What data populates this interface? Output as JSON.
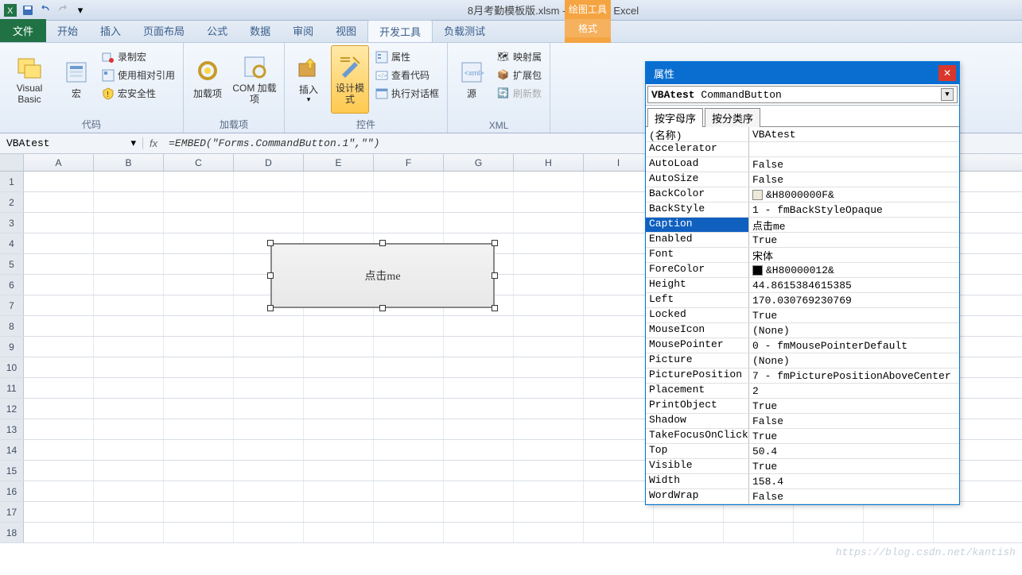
{
  "app": {
    "filename": "8月考勤模板版.xlsm",
    "appname": "Microsoft Excel",
    "context_tool": "绘图工具",
    "context_sub": "格式"
  },
  "tabs": {
    "file": "文件",
    "items": [
      "开始",
      "插入",
      "页面布局",
      "公式",
      "数据",
      "审阅",
      "视图",
      "开发工具",
      "负载测试"
    ],
    "active_index": 7
  },
  "ribbon": {
    "group_code": {
      "label": "代码",
      "vb": "Visual Basic",
      "macros": "宏",
      "record": "录制宏",
      "relative": "使用相对引用",
      "security": "宏安全性"
    },
    "group_addins": {
      "label": "加载项",
      "addins": "加载项",
      "com": "COM 加载项"
    },
    "group_controls": {
      "label": "控件",
      "insert": "插入",
      "design": "设计模式",
      "props": "属性",
      "view_code": "查看代码",
      "dialog": "执行对话框"
    },
    "group_xml": {
      "label": "XML",
      "source": "源",
      "map_props": "映射属",
      "exp_pack": "扩展包",
      "refresh": "刷新数"
    }
  },
  "formula": {
    "name_box": "VBAtest",
    "fx": "fx",
    "value": "=EMBED(\"Forms.CommandButton.1\",\"\")"
  },
  "columns": [
    "A",
    "B",
    "C",
    "D",
    "E",
    "F",
    "G",
    "H",
    "I",
    "",
    "",
    "",
    "N"
  ],
  "rows": [
    "1",
    "2",
    "3",
    "4",
    "5",
    "6",
    "7",
    "8",
    "9",
    "10",
    "11",
    "12",
    "13",
    "14",
    "15",
    "16",
    "17",
    "18"
  ],
  "sheet_button": {
    "caption": "点击me"
  },
  "props": {
    "title": "属性",
    "object_name": "VBAtest",
    "object_type": "CommandButton",
    "tab_alpha": "按字母序",
    "tab_cat": "按分类序",
    "rows": [
      {
        "n": "(名称)",
        "v": "VBAtest"
      },
      {
        "n": "Accelerator",
        "v": ""
      },
      {
        "n": "AutoLoad",
        "v": "False"
      },
      {
        "n": "AutoSize",
        "v": "False"
      },
      {
        "n": "BackColor",
        "v": "&H8000000F&",
        "swatch": "#ece9d8"
      },
      {
        "n": "BackStyle",
        "v": "1 - fmBackStyleOpaque"
      },
      {
        "n": "Caption",
        "v": "点击me",
        "sel": true
      },
      {
        "n": "Enabled",
        "v": "True"
      },
      {
        "n": "Font",
        "v": "宋体"
      },
      {
        "n": "ForeColor",
        "v": "&H80000012&",
        "swatch": "#000000"
      },
      {
        "n": "Height",
        "v": "44.8615384615385"
      },
      {
        "n": "Left",
        "v": "170.030769230769"
      },
      {
        "n": "Locked",
        "v": "True"
      },
      {
        "n": "MouseIcon",
        "v": "(None)"
      },
      {
        "n": "MousePointer",
        "v": "0 - fmMousePointerDefault"
      },
      {
        "n": "Picture",
        "v": "(None)"
      },
      {
        "n": "PicturePosition",
        "v": "7 - fmPicturePositionAboveCenter"
      },
      {
        "n": "Placement",
        "v": "2"
      },
      {
        "n": "PrintObject",
        "v": "True"
      },
      {
        "n": "Shadow",
        "v": "False"
      },
      {
        "n": "TakeFocusOnClick",
        "v": "True"
      },
      {
        "n": "Top",
        "v": "50.4"
      },
      {
        "n": "Visible",
        "v": "True"
      },
      {
        "n": "Width",
        "v": "158.4"
      },
      {
        "n": "WordWrap",
        "v": "False"
      }
    ]
  },
  "watermark": "https://blog.csdn.net/kantish"
}
